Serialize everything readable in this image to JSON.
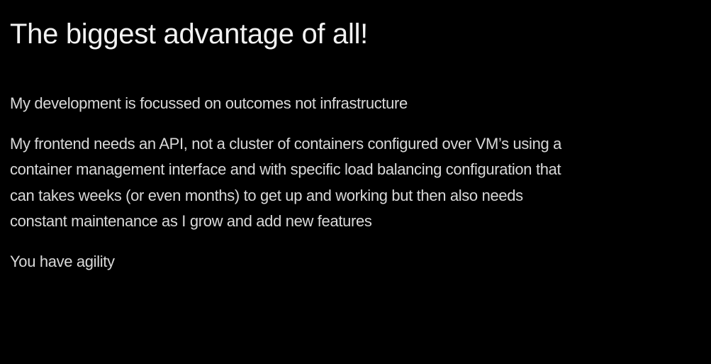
{
  "slide": {
    "title": "The biggest advantage of all!",
    "paragraphs": [
      {
        "lines": [
          "My development is focussed on outcomes not infrastructure"
        ]
      },
      {
        "lines": [
          "My frontend needs an API, not a cluster of containers configured over VM’s using a",
          "container management interface and with specific load balancing configuration that",
          "can takes weeks (or even months) to get up and working but then also needs",
          "constant maintenance as I grow and add new features"
        ]
      },
      {
        "lines": [
          "You have agility"
        ]
      }
    ]
  },
  "colors": {
    "background": "#000000",
    "title_text": "#f2f2f2",
    "body_text": "#d9d9d9"
  }
}
